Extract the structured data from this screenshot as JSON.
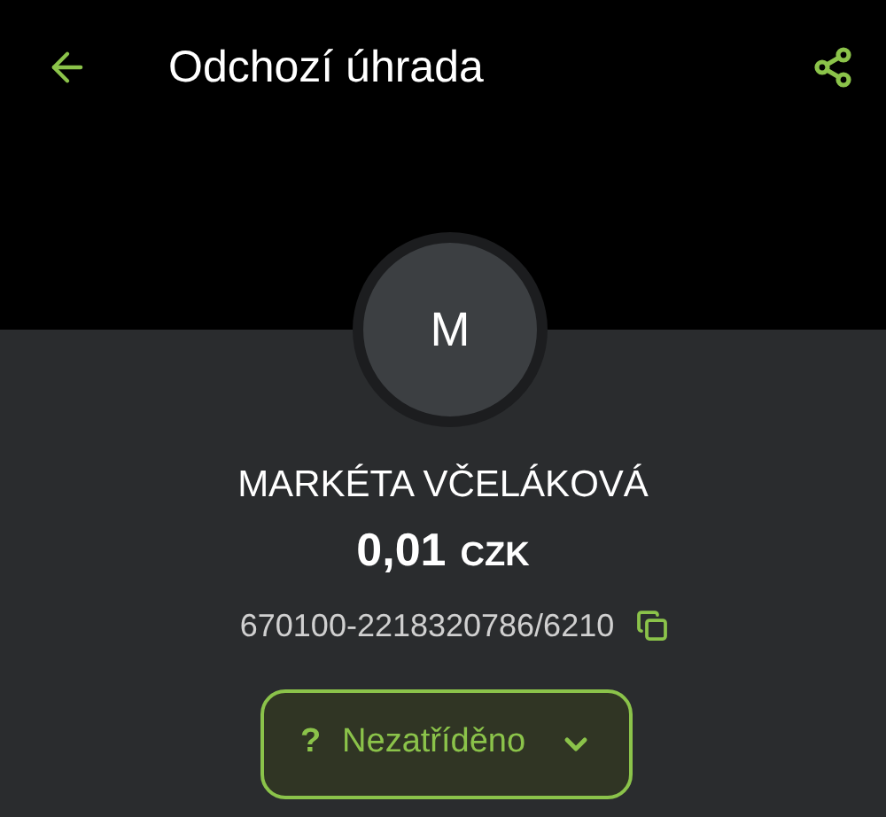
{
  "header": {
    "title": "Odchozí úhrada"
  },
  "counterparty": {
    "initial": "M",
    "name": "MARKÉTA VČELÁKOVÁ",
    "amount": "0,01",
    "currency": "CZK",
    "account": "670100-2218320786/6210"
  },
  "category": {
    "icon": "?",
    "label": "Nezatříděno"
  }
}
